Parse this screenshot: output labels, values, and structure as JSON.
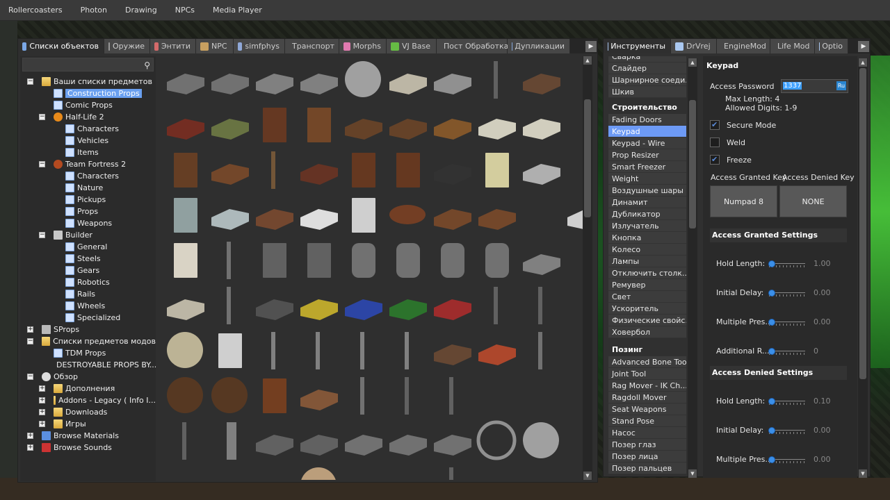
{
  "menubar": {
    "items": [
      "Rollercoasters",
      "Photon",
      "Drawing",
      "NPCs",
      "Media Player"
    ]
  },
  "spawn": {
    "tabs": [
      {
        "label": "Списки объектов",
        "color": "#7aa7e6"
      },
      {
        "label": "Оружие",
        "color": "#999999"
      },
      {
        "label": "Энтити",
        "color": "#d46a6a"
      },
      {
        "label": "NPC",
        "color": "#c8a060"
      },
      {
        "label": "simfphys",
        "color": "#8fa8d8"
      },
      {
        "label": "Транспорт",
        "color": "#8fa8d8"
      },
      {
        "label": "Morphs",
        "color": "#e07ab0"
      },
      {
        "label": "VJ Base",
        "color": "#66bb44"
      },
      {
        "label": "Пост Обработка",
        "color": "#8fb8d8"
      },
      {
        "label": "Дупликации",
        "color": "#88aadd"
      }
    ],
    "tree": [
      {
        "label": "Ваши списки предметов",
        "lvl": 0,
        "exp": "-",
        "ico": "folder"
      },
      {
        "label": "Construction Props",
        "lvl": 1,
        "exp": "",
        "ico": "page",
        "sel": true
      },
      {
        "label": "Comic Props",
        "lvl": 1,
        "exp": "",
        "ico": "page"
      },
      {
        "label": "Half-Life 2",
        "lvl": 1,
        "exp": "-",
        "ico": "hl"
      },
      {
        "label": "Characters",
        "lvl": 2,
        "exp": "",
        "ico": "page"
      },
      {
        "label": "Vehicles",
        "lvl": 2,
        "exp": "",
        "ico": "page"
      },
      {
        "label": "Items",
        "lvl": 2,
        "exp": "",
        "ico": "page"
      },
      {
        "label": "Team Fortress 2",
        "lvl": 1,
        "exp": "-",
        "ico": "tf"
      },
      {
        "label": "Characters",
        "lvl": 2,
        "exp": "",
        "ico": "page"
      },
      {
        "label": "Nature",
        "lvl": 2,
        "exp": "",
        "ico": "page"
      },
      {
        "label": "Pickups",
        "lvl": 2,
        "exp": "",
        "ico": "page"
      },
      {
        "label": "Props",
        "lvl": 2,
        "exp": "",
        "ico": "page"
      },
      {
        "label": "Weapons",
        "lvl": 2,
        "exp": "",
        "ico": "page"
      },
      {
        "label": "Builder",
        "lvl": 1,
        "exp": "-",
        "ico": "tool"
      },
      {
        "label": "General",
        "lvl": 2,
        "exp": "",
        "ico": "page"
      },
      {
        "label": "Steels",
        "lvl": 2,
        "exp": "",
        "ico": "page"
      },
      {
        "label": "Gears",
        "lvl": 2,
        "exp": "",
        "ico": "page"
      },
      {
        "label": "Robotics",
        "lvl": 2,
        "exp": "",
        "ico": "page"
      },
      {
        "label": "Rails",
        "lvl": 2,
        "exp": "",
        "ico": "page"
      },
      {
        "label": "Wheels",
        "lvl": 2,
        "exp": "",
        "ico": "page"
      },
      {
        "label": "Specialized",
        "lvl": 2,
        "exp": "",
        "ico": "page"
      },
      {
        "label": "SProps",
        "lvl": 0,
        "exp": "+",
        "ico": "box"
      },
      {
        "label": "Списки предметов модов",
        "lvl": 0,
        "exp": "-",
        "ico": "folder"
      },
      {
        "label": "TDM Props",
        "lvl": 1,
        "exp": "",
        "ico": "page"
      },
      {
        "label": "DESTROYABLE PROPS BY...",
        "lvl": 1,
        "exp": "",
        "ico": "destroy"
      },
      {
        "label": "Обзор",
        "lvl": 0,
        "exp": "-",
        "ico": "gear"
      },
      {
        "label": "Дополнения",
        "lvl": 1,
        "exp": "+",
        "ico": "folder"
      },
      {
        "label": "Addons - Legacy ( Info I...",
        "lvl": 1,
        "exp": "+",
        "ico": "folder"
      },
      {
        "label": "Downloads",
        "lvl": 1,
        "exp": "+",
        "ico": "folder"
      },
      {
        "label": "Игры",
        "lvl": 1,
        "exp": "+",
        "ico": "folder"
      },
      {
        "label": "Browse Materials",
        "lvl": 0,
        "exp": "+",
        "ico": "mat"
      },
      {
        "label": "Browse Sounds",
        "lvl": 0,
        "exp": "+",
        "ico": "snd"
      }
    ],
    "props": [
      "fence",
      "fence",
      "pipes",
      "bars",
      "fountain",
      "bathtub",
      "bedframe",
      "pole",
      "chair",
      "",
      "sofa",
      "sofa2",
      "cabinet",
      "dresser",
      "crate-tray",
      "crate-tray",
      "board",
      "mattress",
      "mattress",
      "",
      "door",
      "table",
      "stick",
      "desk",
      "shelf",
      "wardrobe",
      "stove",
      "fridge",
      "radiator",
      "",
      "locker",
      "plank",
      "bench",
      "sink",
      "oven",
      "round-table",
      "table",
      "table",
      "",
      "toilet",
      "washer",
      "lamppost",
      "door-frame",
      "door-frame",
      "tombstone",
      "tombstone",
      "tombstone",
      "tombstone",
      "grave",
      "",
      "bathtub",
      "lamppost",
      "cage",
      "cage-yellow",
      "cage-blue",
      "cage-green",
      "cage-red",
      "statue",
      "statue",
      "",
      "lampshade",
      "lockers",
      "ladder",
      "ladder",
      "hook",
      "hook",
      "barrel",
      "barrel-red",
      "rope",
      "",
      "spool",
      "spool",
      "bookshelf",
      "beam",
      "rope",
      "pole",
      "pole",
      "",
      "",
      "",
      "post",
      "pillar",
      "truss",
      "truss",
      "bridge",
      "bridge",
      "arch",
      "tire",
      "windmill",
      "",
      "parasol",
      "armchair",
      "table-red",
      "globe",
      "container",
      "rails",
      "pole",
      "scaffold",
      "",
      "spike"
    ]
  },
  "tools": {
    "tabs": [
      {
        "label": "Инструменты",
        "color": "#aac8f0"
      },
      {
        "label": "DrVrej",
        "color": "#aac8f0"
      },
      {
        "label": "EngineMod",
        "color": "#aac8f0"
      },
      {
        "label": "Life Mod",
        "color": "#aac8f0"
      },
      {
        "label": "Optio",
        "color": "#aac8f0"
      }
    ],
    "list_top": [
      "Сварка",
      "Слайдер",
      "Шарнирное соеди...",
      "Шкив"
    ],
    "cat_build": "Строительство",
    "list_build": [
      "Fading Doors",
      "Keypad",
      "Keypad - Wire",
      "Prop Resizer",
      "Smart Freezer",
      "Weight",
      "Воздушные шары",
      "Динамит",
      "Дубликатор",
      "Излучатель",
      "Кнопка",
      "Колесо",
      "Лампы",
      "Отключить столк...",
      "Ремувер",
      "Свет",
      "Ускоритель",
      "Физические свойс...",
      "Ховербол"
    ],
    "cat_pose": "Позинг",
    "list_pose": [
      "Advanced Bone Tool",
      "Joint Tool",
      "Rag Mover - IK Ch...",
      "Ragdoll Mover",
      "Seat Weapons",
      "Stand Pose",
      "Насос",
      "Позер глаз",
      "Позер лица",
      "Позер пальцев"
    ],
    "selected": "Keypad"
  },
  "keypad": {
    "title": "Keypad",
    "access_password_label": "Access Password",
    "password_value": "1337",
    "lang_badge": "Ru",
    "max_length": "Max Length: 4",
    "allowed_digits": "Allowed Digits: 1-9",
    "secure_mode": "Secure Mode",
    "weld": "Weld",
    "freeze": "Freeze",
    "granted_key_label": "Access Granted Key",
    "denied_key_label": "Access Denied Key",
    "granted_key": "Numpad 8",
    "denied_key": "NONE",
    "granted_settings": "Access Granted Settings",
    "denied_settings": "Access Denied Settings",
    "granted_rows": [
      {
        "label": "Hold Length:",
        "value": "1.00"
      },
      {
        "label": "Initial Delay:",
        "value": "0.00"
      },
      {
        "label": "Multiple Pres...",
        "value": "0.00"
      },
      {
        "label": "Additional R...",
        "value": "0"
      }
    ],
    "denied_rows": [
      {
        "label": "Hold Length:",
        "value": "0.10"
      },
      {
        "label": "Initial Delay:",
        "value": "0.00"
      },
      {
        "label": "Multiple Pres...",
        "value": "0.00"
      }
    ]
  },
  "colors": {
    "accent": "#6d9af5",
    "selected_tree": "#6aa0f0",
    "panel": "#2f2f2f"
  }
}
